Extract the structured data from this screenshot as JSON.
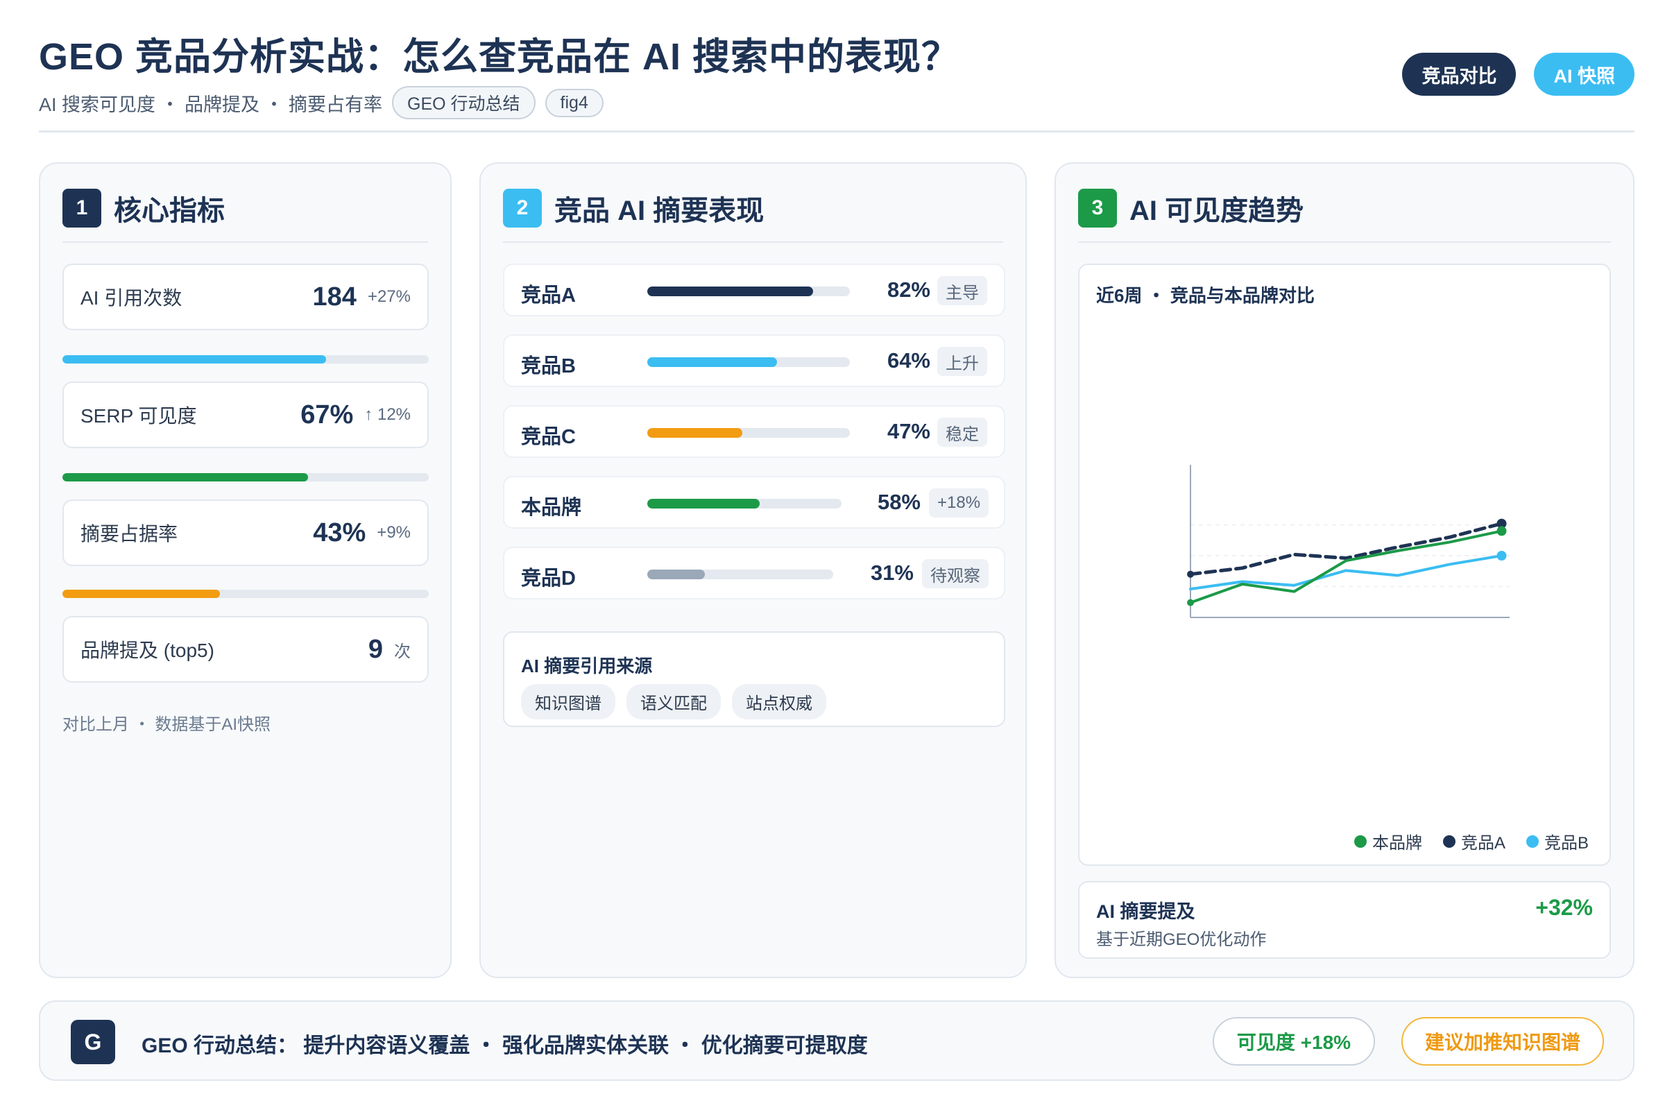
{
  "header": {
    "title": "GEO 竞品分析实战：怎么查竞品在 AI 搜索中的表现？",
    "subtitle": "AI 搜索可见度 ・ 品牌提及 ・ 摘要占有率",
    "chips": [
      "GEO 行动总结",
      "fig4"
    ],
    "buttons": [
      "竞品对比",
      "AI 快照"
    ]
  },
  "panel1": {
    "num": "1",
    "title": "核心指标",
    "metrics": [
      {
        "label": "AI 引用次数",
        "value": "184",
        "delta": "+27%"
      },
      {
        "label": "SERP 可见度",
        "value": "67%",
        "delta": "↑ 12%"
      },
      {
        "label": "摘要占据率",
        "value": "43%",
        "delta": "+9%"
      },
      {
        "label": "品牌提及 (top5)",
        "value": "9",
        "delta": "次"
      }
    ],
    "bars": [
      {
        "fill": 0.72,
        "color": "#3bbdf2"
      },
      {
        "fill": 0.67,
        "color": "#1c9a48"
      },
      {
        "fill": 0.43,
        "color": "#f29c12"
      }
    ],
    "footnote": "对比上月 ・ 数据基于AI快照"
  },
  "panel2": {
    "num": "2",
    "title": "竞品 AI 摘要表现",
    "rows": [
      {
        "name": "竞品A",
        "value": "82%",
        "fill": 0.82,
        "color": "#1e3354",
        "tag": "主导"
      },
      {
        "name": "竞品B",
        "value": "64%",
        "fill": 0.64,
        "color": "#3bbdf2",
        "tag": "上升"
      },
      {
        "name": "竞品C",
        "value": "47%",
        "fill": 0.47,
        "color": "#f29c12",
        "tag": "稳定"
      },
      {
        "name": "本品牌",
        "value": "58%",
        "fill": 0.58,
        "color": "#1c9a48",
        "tag": "+18%"
      },
      {
        "name": "竞品D",
        "value": "31%",
        "fill": 0.31,
        "color": "#9aa8b8",
        "tag": "待观察"
      }
    ],
    "sources": {
      "title": "AI 摘要引用来源",
      "chips": [
        "知识图谱",
        "语义匹配",
        "站点权威"
      ]
    }
  },
  "panel3": {
    "num": "3",
    "title": "AI 可见度趋势",
    "chart_caption": "近6周 ・ 竞品与本品牌对比",
    "summary": {
      "title": "AI 摘要提及",
      "sub": "基于近期GEO优化动作",
      "value": "+32%"
    }
  },
  "chart_data": {
    "type": "line",
    "title": "近6周 ・ 竞品与本品牌对比",
    "x": [
      1,
      2,
      3,
      4,
      5,
      6,
      7
    ],
    "ylim": [
      0,
      100
    ],
    "grid": true,
    "legend_position": "bottom-right",
    "series": [
      {
        "name": "本品牌",
        "color": "#1c9a48",
        "dashed": false,
        "values": [
          12,
          27,
          21,
          46,
          54,
          61,
          70
        ]
      },
      {
        "name": "竞品A",
        "color": "#1e3354",
        "dashed": true,
        "values": [
          35,
          40,
          51,
          48,
          57,
          65,
          76
        ]
      },
      {
        "name": "竞品B",
        "color": "#3bbdf2",
        "dashed": false,
        "values": [
          23,
          29,
          26,
          38,
          34,
          43,
          50
        ]
      }
    ]
  },
  "footer": {
    "badge": "G",
    "text": "GEO 行动总结：  提升内容语义覆盖 ・ 强化品牌实体关联 ・ 优化摘要可提取度",
    "btn_visibility": "可见度 +18%",
    "btn_advice": "建议加推知识图谱"
  }
}
